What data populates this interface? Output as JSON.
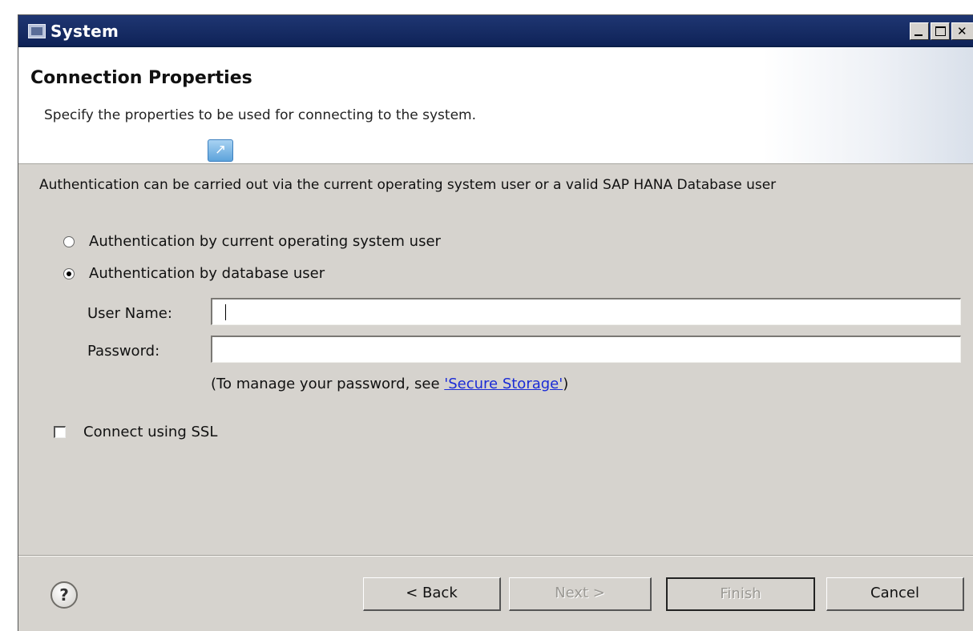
{
  "window": {
    "title": "System"
  },
  "header": {
    "title": "Connection Properties",
    "description": "Specify the properties to be used for connecting to the system."
  },
  "intro_text": "Authentication can be carried out via the current operating system user or a valid SAP HANA Database user",
  "auth_options": [
    {
      "label": "Authentication by current operating system user",
      "selected": false
    },
    {
      "label": "Authentication by database user",
      "selected": true
    }
  ],
  "fields": {
    "user_name_label": "User Name:",
    "user_name_value": "",
    "password_label": "Password:",
    "password_value": ""
  },
  "password_note": {
    "prefix": "(To manage your password, see ",
    "link": "'Secure Storage'",
    "suffix": ")"
  },
  "ssl": {
    "label": "Connect using SSL",
    "checked": false
  },
  "buttons": {
    "help": "?",
    "back": "< Back",
    "next": "Next >",
    "finish": "Finish",
    "cancel": "Cancel"
  },
  "icons": {
    "window": "window-icon",
    "wizard": "wizard-arrow-icon",
    "help": "help-icon"
  }
}
